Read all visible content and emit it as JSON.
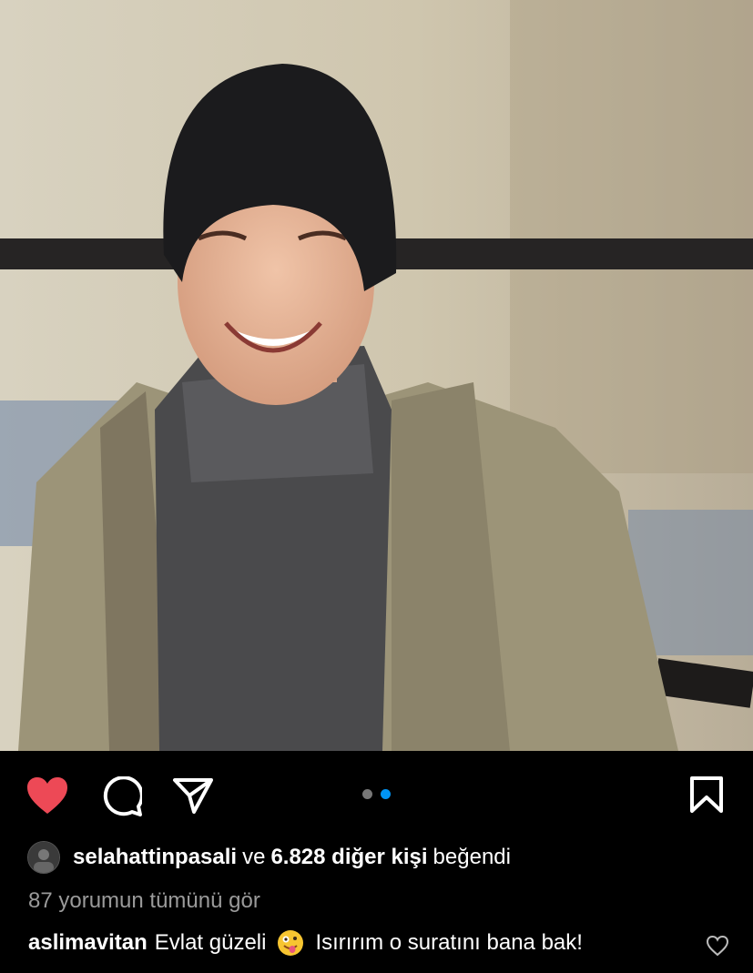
{
  "post": {
    "image_alt": "Smiling young man in a black beanie, grey knit turtleneck and olive jacket"
  },
  "actions": {
    "like_icon": "heart-filled-icon",
    "comment_icon": "comment-bubble-icon",
    "share_icon": "paper-plane-icon",
    "save_icon": "bookmark-icon",
    "like_color": "#ed4956",
    "carousel": {
      "count": 2,
      "active": 2,
      "active_color": "#0095f6",
      "inactive_color": "#777777"
    }
  },
  "likes": {
    "username": "selahattinpasali",
    "connector": "ve",
    "others": "6.828 diğer kişi",
    "suffix": "beğendi"
  },
  "comments": {
    "view_all": "87 yorumun tümünü gör"
  },
  "caption": {
    "username": "aslimavitan",
    "text_before": "Evlat güzeli",
    "emoji": "zany-face-emoji",
    "text_after": "Isırırım o suratını bana bak!"
  }
}
